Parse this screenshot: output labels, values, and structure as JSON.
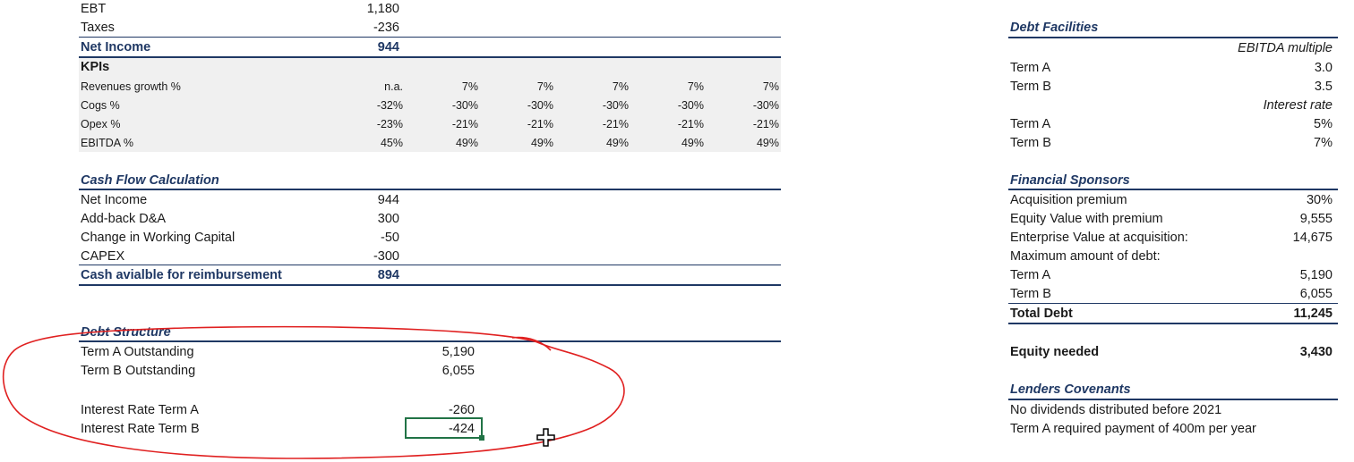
{
  "income": {
    "ebt": {
      "label": "EBT",
      "value": "1,180"
    },
    "taxes": {
      "label": "Taxes",
      "value": "-236"
    },
    "net_income": {
      "label": "Net Income",
      "value": "944"
    }
  },
  "kpis": {
    "title": "KPIs",
    "rows": [
      {
        "label": "Revenues growth %",
        "values": [
          "n.a.",
          "7%",
          "7%",
          "7%",
          "7%",
          "7%"
        ]
      },
      {
        "label": "Cogs %",
        "values": [
          "-32%",
          "-30%",
          "-30%",
          "-30%",
          "-30%",
          "-30%"
        ]
      },
      {
        "label": "Opex %",
        "values": [
          "-23%",
          "-21%",
          "-21%",
          "-21%",
          "-21%",
          "-21%"
        ]
      },
      {
        "label": "EBITDA %",
        "values": [
          "45%",
          "49%",
          "49%",
          "49%",
          "49%",
          "49%"
        ]
      }
    ]
  },
  "cash_flow": {
    "title": "Cash Flow Calculation",
    "rows": [
      {
        "label": "Net Income",
        "value": "944"
      },
      {
        "label": "Add-back D&A",
        "value": "300"
      },
      {
        "label": "Change in Working Capital",
        "value": "-50"
      },
      {
        "label": "CAPEX",
        "value": "-300"
      }
    ],
    "total": {
      "label": "Cash avialble for reimbursement",
      "value": "894"
    }
  },
  "debt_structure": {
    "title": "Debt Structure",
    "term_a_out": {
      "label": "Term A Outstanding",
      "value": "5,190"
    },
    "term_b_out": {
      "label": "Term B Outstanding",
      "value": "6,055"
    },
    "rate_a": {
      "label": "Interest Rate Term A",
      "value": "-260"
    },
    "rate_b": {
      "label": "Interest Rate Term B",
      "value": "-424"
    }
  },
  "debt_facilities": {
    "title": "Debt Facilities",
    "multiple_header": "EBITDA multiple",
    "multiples": [
      {
        "label": "Term A",
        "value": "3.0"
      },
      {
        "label": "Term B",
        "value": "3.5"
      }
    ],
    "rate_header": "Interest rate",
    "rates": [
      {
        "label": "Term A",
        "value": "5%"
      },
      {
        "label": "Term B",
        "value": "7%"
      }
    ]
  },
  "sponsors": {
    "title": "Financial Sponsors",
    "rows": [
      {
        "label": "Acquisition premium",
        "value": "30%"
      },
      {
        "label": "Equity Value with premium",
        "value": "9,555"
      },
      {
        "label": "Enterprise Value at acquisition:",
        "value": "14,675"
      },
      {
        "label": "Maximum amount of debt:",
        "value": ""
      },
      {
        "label": "Term A",
        "value": "5,190"
      },
      {
        "label": "Term B",
        "value": "6,055"
      }
    ],
    "total_debt": {
      "label": "Total Debt",
      "value": "11,245"
    },
    "equity_needed": {
      "label": "Equity needed",
      "value": "3,430"
    }
  },
  "covenants": {
    "title": "Lenders Covenants",
    "items": [
      "No dividends distributed before 2021",
      "Term A required payment of 400m per year"
    ]
  },
  "colors": {
    "navy": "#1f3864",
    "selection": "#217346",
    "annotation": "#e02020"
  }
}
